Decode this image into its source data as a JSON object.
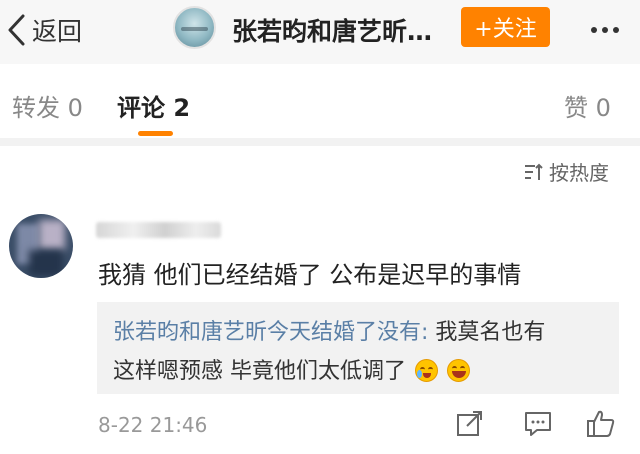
{
  "header": {
    "back_label": "返回",
    "title": "张若昀和唐艺昕…",
    "follow_label": "+关注"
  },
  "tabs": {
    "repost": "转发 0",
    "comment": "评论 2",
    "like": "赞 0"
  },
  "sort": {
    "label": "按热度"
  },
  "comment": {
    "text": "我猜 他们已经结婚了 公布是迟早的事情",
    "reply": {
      "author": "张若昀和唐艺昕今天结婚了没有:",
      "line1_text": " 我莫名也有",
      "line2_text": "这样嗯预感 毕竟他们太低调了"
    },
    "time": "8-22 21:46"
  },
  "icons": [
    "chevron-left-icon",
    "more-icon",
    "sort-icon",
    "share-icon",
    "comment-icon",
    "thumbs-up-icon"
  ],
  "colors": {
    "accent": "#ff8200",
    "link": "#5a7fa6",
    "header_bg": "#f7f7f7",
    "reply_bg": "#f2f2f2"
  }
}
